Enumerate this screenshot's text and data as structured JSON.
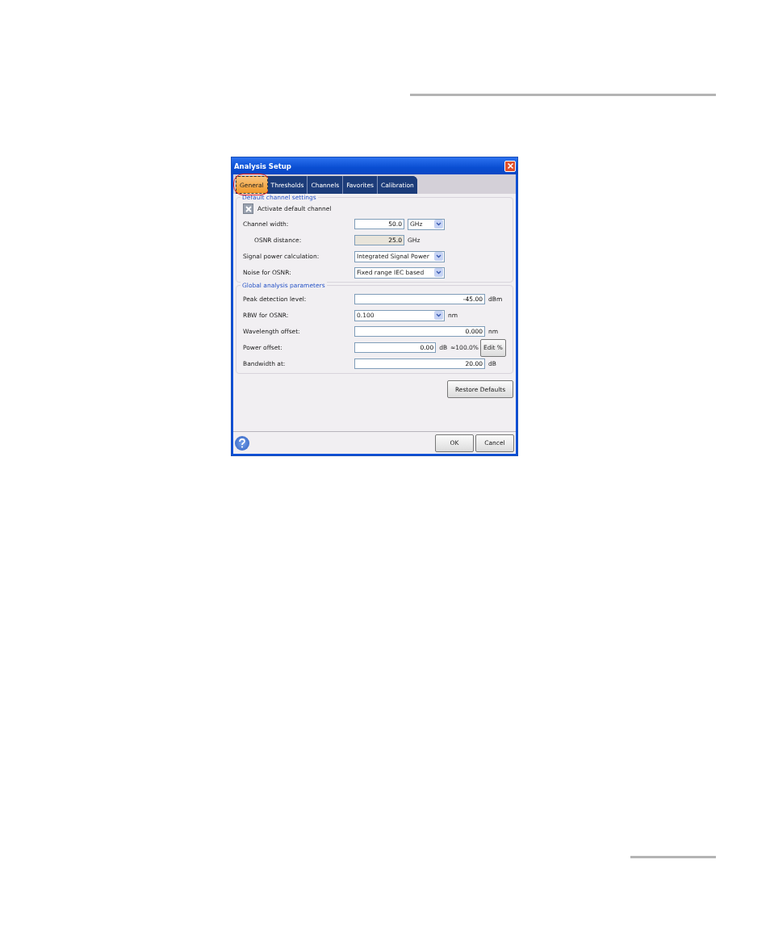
{
  "window": {
    "title": "Analysis Setup"
  },
  "tabs": [
    {
      "label": "General",
      "selected": true,
      "circled": true
    },
    {
      "label": "Thresholds",
      "selected": false,
      "circled": false
    },
    {
      "label": "Channels",
      "selected": false,
      "circled": false
    },
    {
      "label": "Favorites",
      "selected": false,
      "circled": false
    },
    {
      "label": "Calibration",
      "selected": false,
      "circled": false
    }
  ],
  "groups": [
    {
      "title": "Default channel settings",
      "checkbox": {
        "label": "Activate default channel",
        "checked": true
      },
      "rows": [
        {
          "kind": "input",
          "label": "Channel width:",
          "value": "50.0",
          "select": "GHz"
        },
        {
          "kind": "readonly",
          "label": "OSNR distance:",
          "value": "25.0",
          "unit": "GHz"
        },
        {
          "kind": "select",
          "label": "Signal power calculation:",
          "value": "Integrated Signal Power"
        },
        {
          "kind": "select",
          "label": "Noise for OSNR:",
          "value": "Fixed range IEC based"
        }
      ]
    },
    {
      "title": "Global analysis parameters",
      "rows": [
        {
          "kind": "wide",
          "label": "Peak detection level:",
          "value": "-45.00",
          "unit": "dBm"
        },
        {
          "kind": "select",
          "label": "RBW for OSNR:",
          "value": "0.100",
          "unit": "nm"
        },
        {
          "kind": "wide",
          "label": "Wavelength offset:",
          "value": "0.000",
          "unit": "nm"
        },
        {
          "kind": "wide",
          "label": "Power offset:",
          "value": "0.00",
          "unit": "dB",
          "note": "≈100.0%",
          "button": "Edit %"
        },
        {
          "kind": "wide",
          "label": "Bandwidth at:",
          "value": "20.00",
          "unit": "dB"
        }
      ]
    }
  ],
  "restore_button": "Restore Defaults",
  "footer_buttons": [
    "OK",
    "Cancel"
  ]
}
